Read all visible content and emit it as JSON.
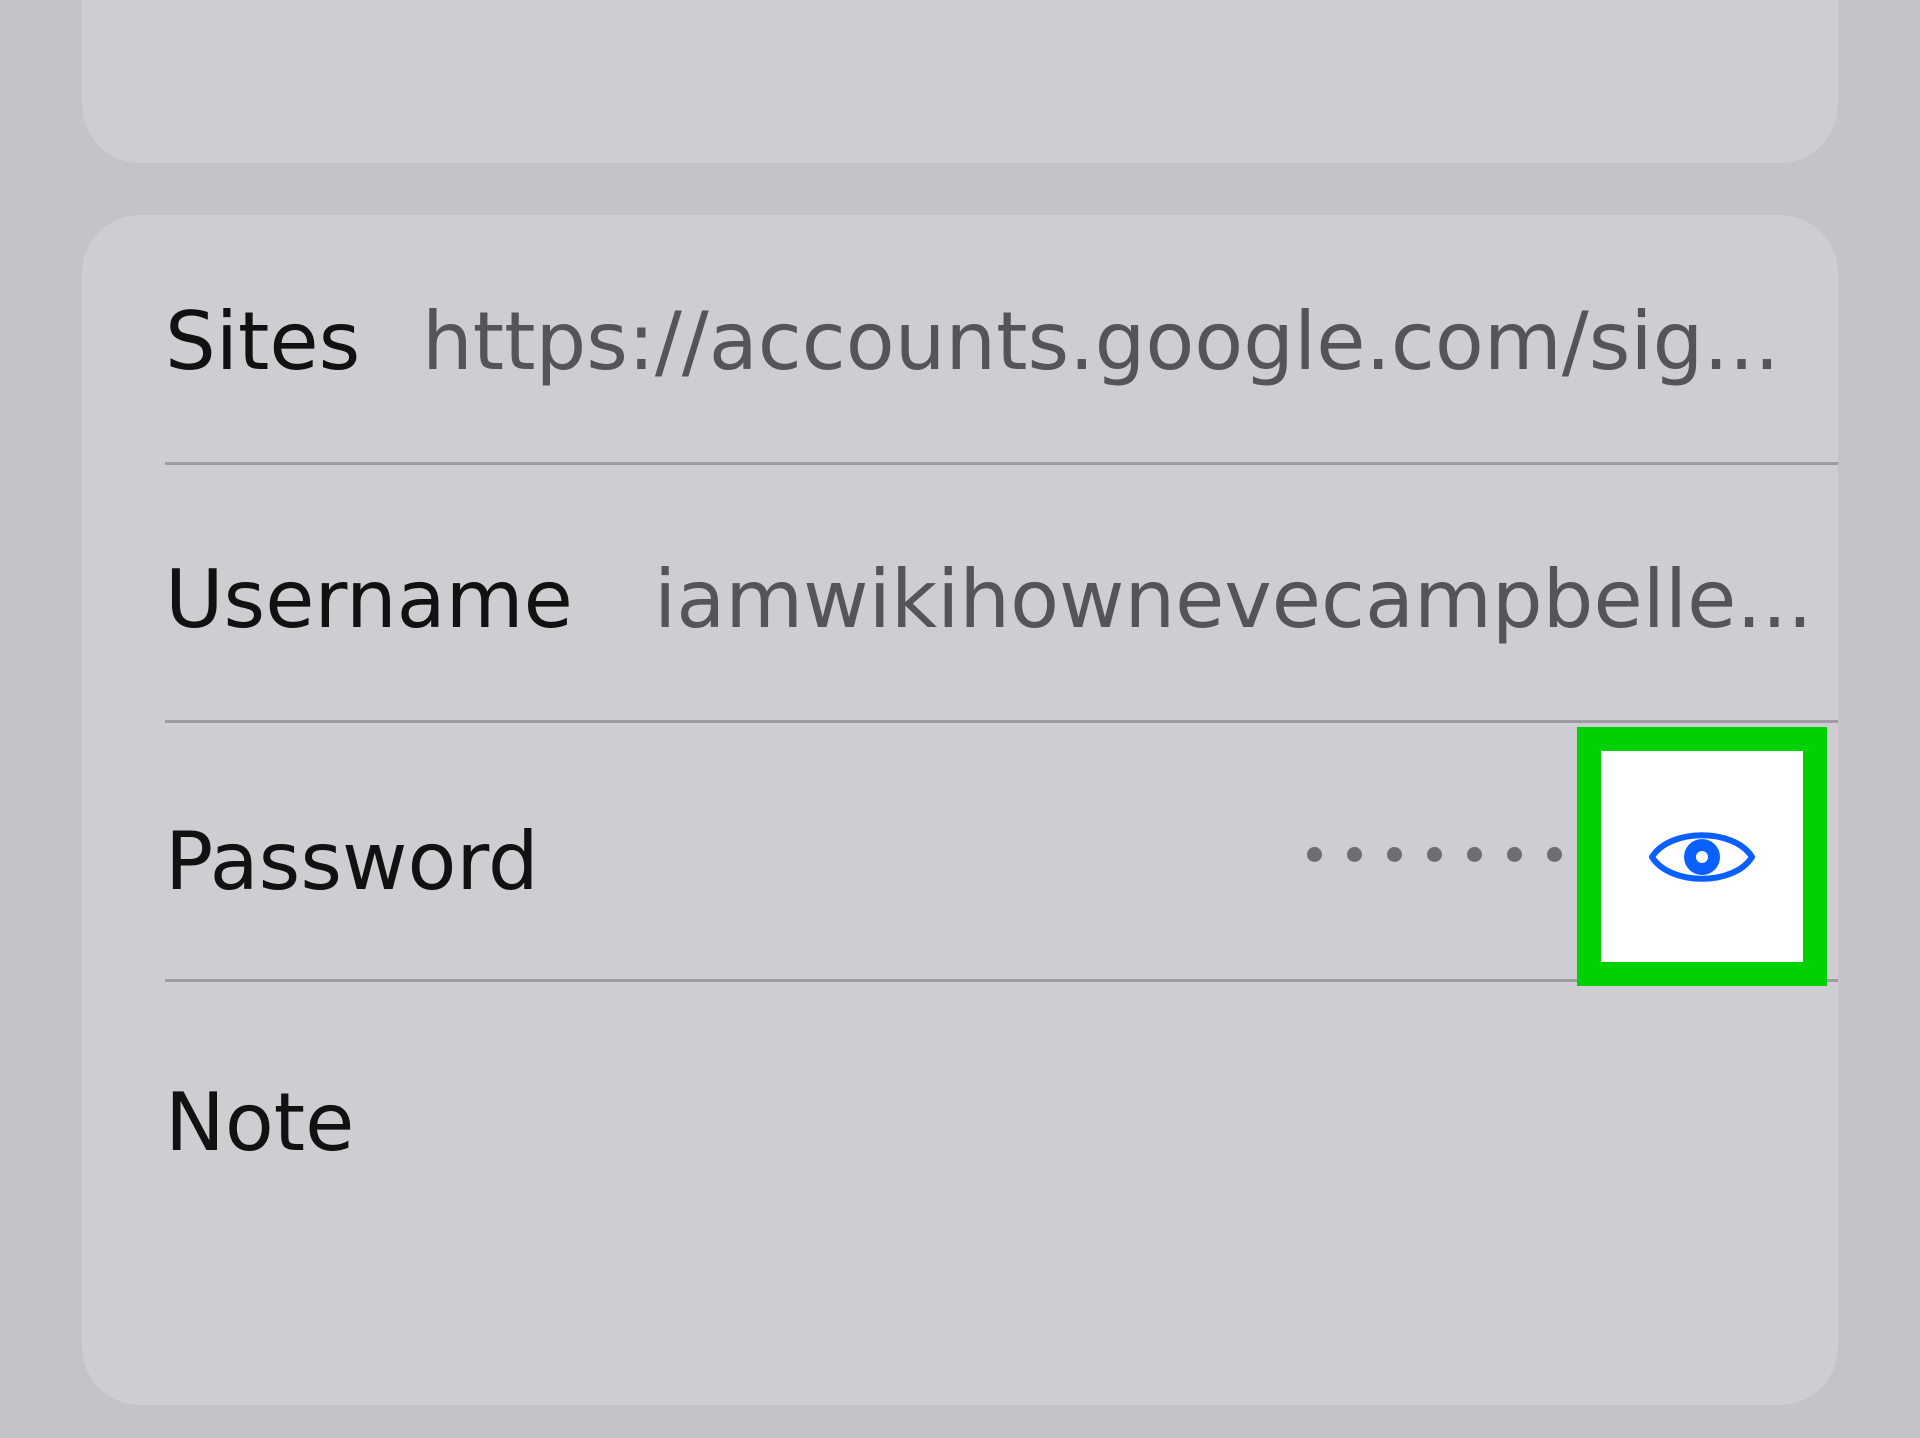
{
  "fields": {
    "sites": {
      "label": "Sites",
      "value": "https://accounts.google.com/sig..."
    },
    "username": {
      "label": "Username",
      "value": "iamwikihownevecampbelle..."
    },
    "password": {
      "label": "Password",
      "masked_value": "••••••••",
      "reveal_icon": "eye-icon"
    },
    "note": {
      "label": "Note"
    }
  },
  "colors": {
    "background": "#c4c3c8",
    "card": "#cecdd1",
    "accent": "#0a60ff",
    "highlight": "#00d100"
  }
}
